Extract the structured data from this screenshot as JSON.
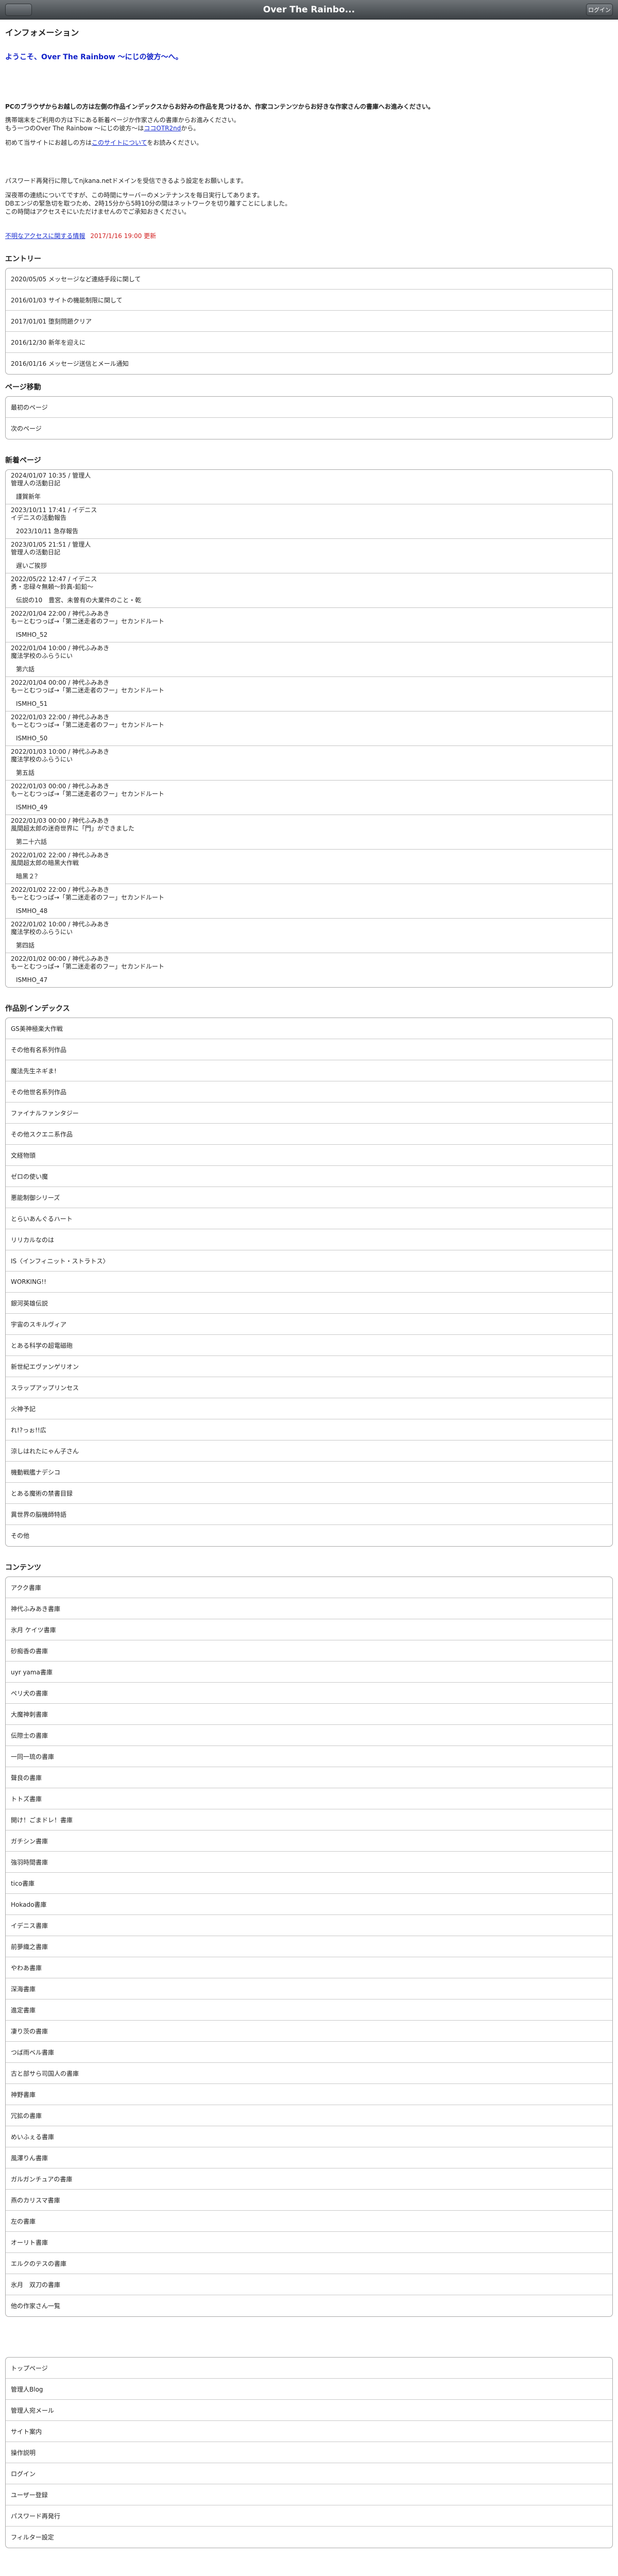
{
  "header": {
    "title": "Over The Rainbo...",
    "right_button": "ログイン"
  },
  "info": {
    "heading": "インフォメーション",
    "welcome": "ようこそ、Over The Rainbow ～にじの彼方～へ。",
    "lead": "PCのブラウザからお越しの方は左側の作品インデックスからお好みの作品を見つけるか、作家コンテンツからお好きな作家さんの書庫へお進みください。",
    "l1": "携帯端末をご利用の方は下にある新着ページか作家さんの書庫からお進みください。",
    "l2_prefix": "もう一つのOver The Rainbow ～にじの彼方～は",
    "l2_link": "ココOTR2nd",
    "l2_suffix": "から。",
    "l3_prefix": "初めて当サイトにお越しの方は",
    "l3_link": "このサイトについて",
    "l3_suffix": "をお読みください。",
    "p1": "パスワード再発行に際してnjkana.netドメインを受信できるよう設定をお願いします。",
    "p2": "深夜帯の連続についてですが、この時間にサーバーのメンテナンスを毎日実行してあります。",
    "p3": "DBエンジの緊急切を取つため、2時15分から5時10分の間はネットワークを切り離すことにしました。",
    "p4": "この時間はアクセスそにいただけませんのでご承知おきください。",
    "notice_link": "不明なアクセスに関する情報",
    "notice_date": "2017/1/16 19:00 更新"
  },
  "entries": {
    "heading": "エントリー",
    "items": [
      "2020/05/05 メッセージなど連絡手段に関して",
      "2016/01/03 サイトの機能制限に関して",
      "2017/01/01 堕刻問題クリア",
      "2016/12/30 新年を迎えに",
      "2016/01/16 メッセージ送信とメール通知"
    ]
  },
  "paging": {
    "heading": "ページ移動",
    "items": [
      "最初のページ",
      "次のページ"
    ]
  },
  "news": {
    "heading": "新着ページ",
    "items": [
      {
        "meta": "2024/01/07 10:35 / 管理人",
        "title": "管理人の活動日記",
        "sub": "謹賀新年"
      },
      {
        "meta": "2023/10/11 17:41 / イデニス",
        "title": "イデニスの活動報告",
        "sub": "2023/10/11 急存報告"
      },
      {
        "meta": "2023/01/05 21:51 / 管理人",
        "title": "管理人の活動日記",
        "sub": "遅いご挨拶"
      },
      {
        "meta": "2022/05/22 12:47 / イデニス",
        "title": "勇・忠碌々無頼～鈴真-鉛鉛～",
        "sub": "伝説の10　豊宮、未曽有の大業件のこと・乾"
      },
      {
        "meta": "2022/01/04 22:00 / 神代ふみあき",
        "title": "もーとむつっぱ→「第二迷走者のフー」セカンドルート",
        "sub": "ISMHO_52"
      },
      {
        "meta": "2022/01/04 10:00 / 神代ふみあき",
        "title": "魔法学校のふらうにい",
        "sub": "第六話"
      },
      {
        "meta": "2022/01/04 00:00 / 神代ふみあき",
        "title": "もーとむつっぱ→「第二迷走者のフー」セカンドルート",
        "sub": "ISMHO_51"
      },
      {
        "meta": "2022/01/03 22:00 / 神代ふみあき",
        "title": "もーとむつっぱ→「第二迷走者のフー」セカンドルート",
        "sub": "ISMHO_50"
      },
      {
        "meta": "2022/01/03 10:00 / 神代ふみあき",
        "title": "魔法学校のふらうにい",
        "sub": "第五話"
      },
      {
        "meta": "2022/01/03 00:00 / 神代ふみあき",
        "title": "もーとむつっぱ→「第二迷走者のフー」セカンドルート",
        "sub": "ISMHO_49"
      },
      {
        "meta": "2022/01/03 00:00 / 神代ふみあき",
        "title": "風間超太郎の迷奇世界に「門」ができました",
        "sub": "第二十六話"
      },
      {
        "meta": "2022/01/02 22:00 / 神代ふみあき",
        "title": "風間超太郎の暗黒大作戦",
        "sub": "暗黒２？"
      },
      {
        "meta": "2022/01/02 22:00 / 神代ふみあき",
        "title": "もーとむつっぱ→「第二迷走者のフー」セカンドルート",
        "sub": "ISMHO_48"
      },
      {
        "meta": "2022/01/02 10:00 / 神代ふみあき",
        "title": "魔法学校のふらうにい",
        "sub": "第四話"
      },
      {
        "meta": "2022/01/02 00:00 / 神代ふみあき",
        "title": "もーとむつっぱ→「第二迷走者のフー」セカンドルート",
        "sub": "ISMHO_47"
      }
    ]
  },
  "index": {
    "heading": "作品別インデックス",
    "items": [
      "GS美神極楽大作戦",
      "その他有名系列作品",
      "魔法先生ネギま!",
      "その他世名系列作品",
      "ファイナルファンタジー",
      "その他スクエニ系作品",
      "文経物頭",
      "ゼロの使い魔",
      "悪能制御シリーズ",
      "とらいあんぐるハート",
      "リリカルなのは",
      "IS〈インフィニット・ストラトス〉",
      "WORKING!!",
      "銀河英雄伝説",
      "宇宙のスキルヴィア",
      "とある科学の超電磁砲",
      "新世紀エヴァンゲリオン",
      "スラップアップリンセス",
      "火神予記",
      "れ!?っぉ!!広",
      "涼しはれたにゃん子さん",
      "機動戦艦ナデシコ",
      "とある魔術の禁書目録",
      "異世界の脳機師特語",
      "その他"
    ]
  },
  "contents": {
    "heading": "コンテンツ",
    "items": [
      "アクク書庫",
      "神代ふみあき書庫",
      "氷月 ケイツ書庫",
      "砂痴香の書庫",
      "uyr yama書庫",
      "ペリ犬の書庫",
      "大魔神刺書庫",
      "伝際士の書庫",
      "一同一琉の書庫",
      "聲良の書庫",
      "トトズ書庫",
      "開け！ごまドレ！書庫",
      "ガチシン書庫",
      "強羽時間書庫",
      "tico書庫",
      "Hokado書庫",
      "イデニス書庫",
      "前夢織之書庫",
      "やわあ書庫",
      "深海書庫",
      "進定書庫",
      "凄り茨の書庫",
      "つば雨ベル書庫",
      "古と部サら司国人の書庫",
      "神野書庫",
      "冗拡の書庫",
      "めいふぇる書庫",
      "風澤りん書庫",
      "ガルガンチュアの書庫",
      "燕のカリスマ書庫",
      "左の書庫",
      "オーリト書庫",
      "エルクのテスの書庫",
      "氷月　双刀の書庫",
      "他の作家さん一覧"
    ]
  },
  "footer": {
    "items": [
      "トップページ",
      "管理人Blog",
      "管理人宛メール",
      "サイト案内",
      "操作説明",
      "ログイン",
      "ユーザー登録",
      "パスワード再発行",
      "フィルター設定"
    ]
  }
}
